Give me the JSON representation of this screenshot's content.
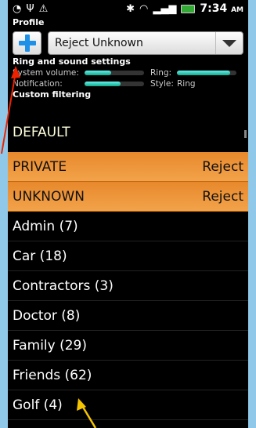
{
  "status": {
    "time": "7:34",
    "ampm": "AM"
  },
  "profile": {
    "section_label": "Profile",
    "selected": "Reject Unknown"
  },
  "ring_settings": {
    "section_label": "Ring and sound settings",
    "system_volume_label": "System volume:",
    "system_volume_level": 0.45,
    "ring_label": "Ring:",
    "ring_level": 0.9,
    "notification_label": "Notification:",
    "notification_level": 0.6,
    "style_label": "Style:",
    "style_value": "Ring"
  },
  "filtering": {
    "section_label": "Custom filtering",
    "default_label": "DEFAULT",
    "rows": [
      {
        "name": "PRIVATE",
        "action": "Reject",
        "highlight": true
      },
      {
        "name": "UNKNOWN",
        "action": "Reject",
        "highlight": true
      },
      {
        "name": "Admin (7)",
        "action": ""
      },
      {
        "name": "Car (18)",
        "action": ""
      },
      {
        "name": "Contractors (3)",
        "action": ""
      },
      {
        "name": "Doctor (8)",
        "action": ""
      },
      {
        "name": "Family (29)",
        "action": ""
      },
      {
        "name": "Friends (62)",
        "action": ""
      },
      {
        "name": "Golf (4)",
        "action": ""
      }
    ]
  },
  "colors": {
    "highlight": "#f0a040",
    "accent": "#1e90e8",
    "annotation_arrow_left": "#ee2200",
    "annotation_arrow_bottom": "#f5c400"
  }
}
